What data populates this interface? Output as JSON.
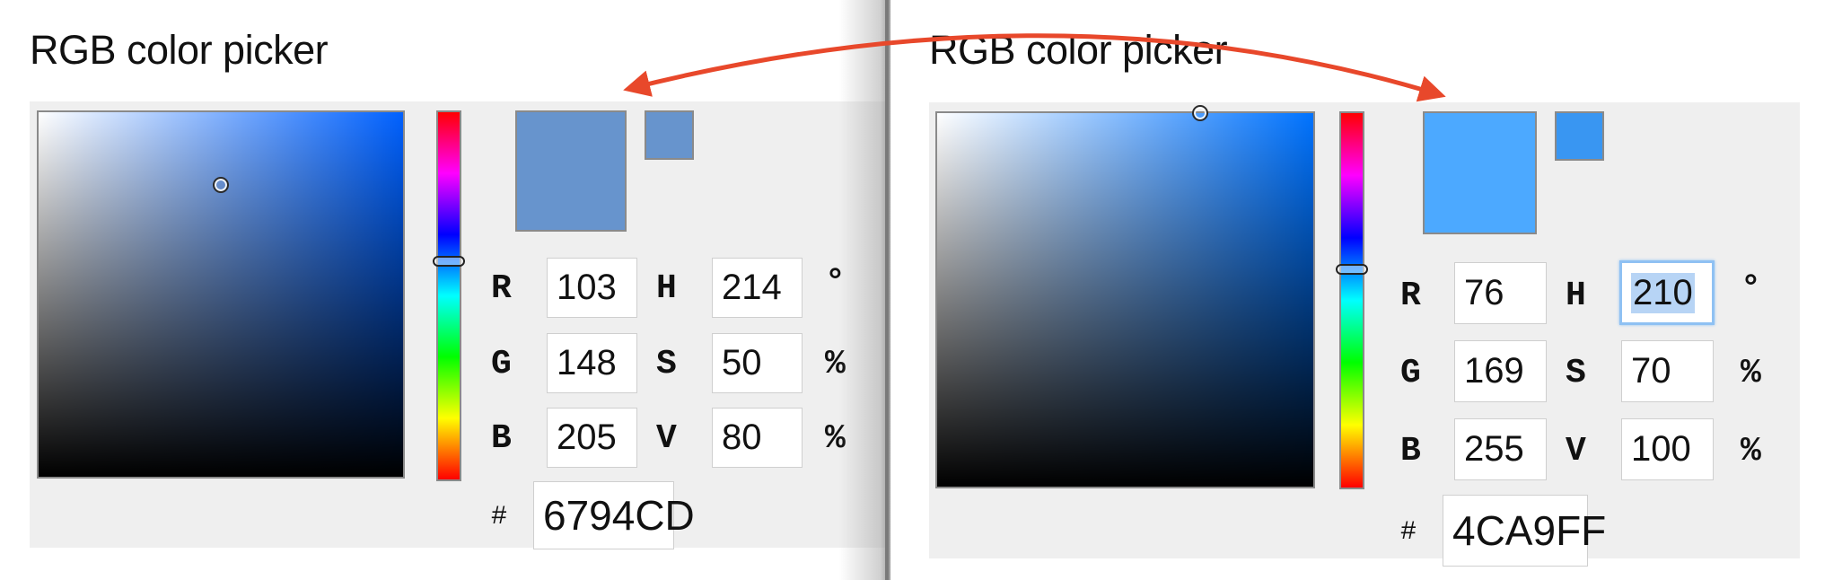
{
  "left": {
    "title": "RGB color picker",
    "hue_deg": 214,
    "sv_cursor": {
      "saturation_pct": 50,
      "value_pct": 80
    },
    "preview_color": "#6794CD",
    "swatch_color": "#6794CD",
    "fields": {
      "r": {
        "label": "R",
        "value": "103"
      },
      "g": {
        "label": "G",
        "value": "148"
      },
      "b": {
        "label": "B",
        "value": "205"
      },
      "h": {
        "label": "H",
        "value": "214",
        "unit": "°"
      },
      "s": {
        "label": "S",
        "value": "50",
        "unit": "%"
      },
      "v": {
        "label": "V",
        "value": "80",
        "unit": "%"
      }
    },
    "hex": {
      "label": "#",
      "value": "6794CD"
    }
  },
  "right": {
    "title": "RGB color picker",
    "hue_deg": 210,
    "sv_cursor": {
      "saturation_pct": 70,
      "value_pct": 100
    },
    "preview_color": "#4CA9FF",
    "swatch_color": "#3996F2",
    "fields": {
      "r": {
        "label": "R",
        "value": "76"
      },
      "g": {
        "label": "G",
        "value": "169"
      },
      "b": {
        "label": "B",
        "value": "255"
      },
      "h": {
        "label": "H",
        "value": "210",
        "unit": "°",
        "focused": true,
        "selected": true
      },
      "s": {
        "label": "S",
        "value": "70",
        "unit": "%"
      },
      "v": {
        "label": "V",
        "value": "100",
        "unit": "%"
      }
    },
    "hex": {
      "label": "#",
      "value": "4CA9FF"
    }
  },
  "colors": {
    "arrow": "#E8482B",
    "panel_bg": "#EFEFEF",
    "hue_base_left": "#0061FF",
    "hue_base_right": "#0073FF"
  }
}
